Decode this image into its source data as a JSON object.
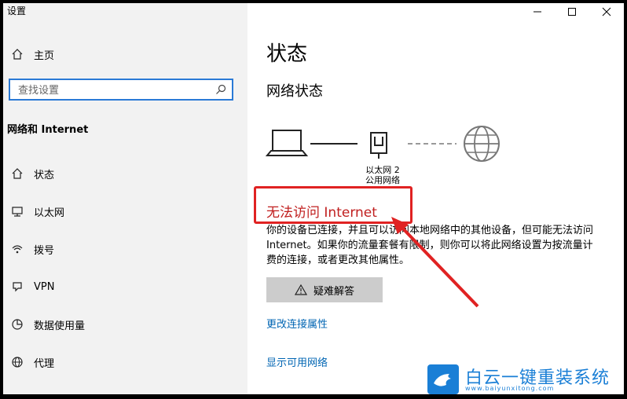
{
  "window": {
    "title": "设置",
    "controls": {
      "minimize": "—",
      "maximize": "☐",
      "close": "✕"
    }
  },
  "sidebar": {
    "home_label": "主页",
    "search_placeholder": "查找设置",
    "section_title": "网络和 Internet",
    "items": [
      {
        "label": "状态",
        "icon": "home-status-icon"
      },
      {
        "label": "以太网",
        "icon": "ethernet-icon"
      },
      {
        "label": "拨号",
        "icon": "dialup-icon"
      },
      {
        "label": "VPN",
        "icon": "vpn-icon"
      },
      {
        "label": "数据使用量",
        "icon": "data-usage-icon"
      },
      {
        "label": "代理",
        "icon": "globe-icon"
      }
    ]
  },
  "main": {
    "title": "状态",
    "subheading": "网络状态",
    "network": {
      "adapter_name": "以太网 2",
      "network_type": "公用网络"
    },
    "alert": "无法访问 Internet",
    "description": "你的设备已连接，并且可以访问本地网络中的其他设备，但可能无法访问 Internet。如果你的流量套餐有限制，则你可以将此网络设置为按流量计费的连接，或者更改其他属性。",
    "troubleshoot_label": "疑难解答",
    "links": {
      "change_properties": "更改连接属性",
      "show_networks": "显示可用网络"
    },
    "colors": {
      "alert": "#c01e1e",
      "link": "#0065b3",
      "highlight_box": "#e02222"
    }
  },
  "watermark": {
    "brand": "白云一键重装系统",
    "url": "www.baiyunxitong.com"
  }
}
